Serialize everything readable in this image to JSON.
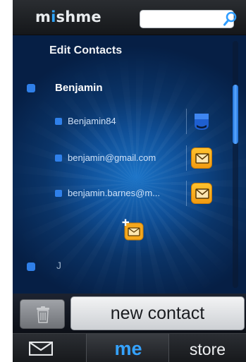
{
  "header": {
    "logo_text_before": "m",
    "logo_text_i": "i",
    "logo_text_after": "shme",
    "search": {
      "value": "",
      "placeholder": ""
    }
  },
  "panel": {
    "title": "Edit Contacts",
    "contact": {
      "name": "Benjamin",
      "details": [
        {
          "text": "Benjamin84",
          "action_icon": "im-icon"
        },
        {
          "text": "benjamin@gmail.com",
          "action_icon": "mail-icon"
        },
        {
          "text": "benjamin.barnes@m...",
          "action_icon": "mail-icon"
        }
      ]
    },
    "next_contact_name": "J"
  },
  "actions": {
    "new_contact_label": "new contact"
  },
  "tabs": {
    "me_label": "me",
    "store_label": "store"
  },
  "colors": {
    "accent": "#35a3ff",
    "mail_button": "#f5a81d",
    "panel_glow": "#1b74c8"
  }
}
